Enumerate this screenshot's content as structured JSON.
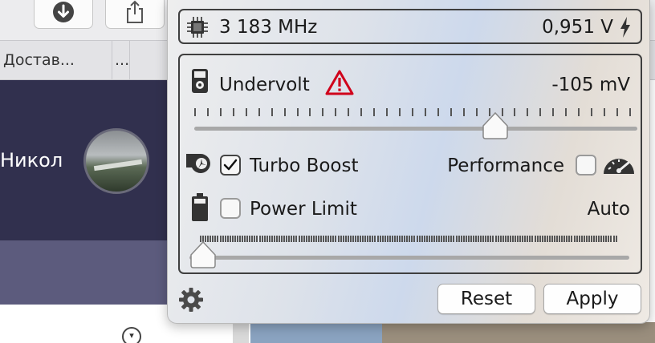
{
  "background": {
    "tabs": [
      {
        "label": "Достав..."
      },
      {
        "label": "..."
      }
    ],
    "profile_name": "Никол"
  },
  "status": {
    "cpu_frequency": "3 183 MHz",
    "core_voltage": "0,951 V"
  },
  "undervolt": {
    "label": "Undervolt",
    "value": "-105 mV",
    "slider_fraction": 0.68
  },
  "turbo_boost": {
    "label": "Turbo Boost",
    "checked": true
  },
  "performance": {
    "label": "Performance",
    "checked": false
  },
  "power_limit": {
    "label": "Power Limit",
    "checked": false,
    "value": "Auto",
    "slider_fraction": 0.0
  },
  "footer": {
    "reset_label": "Reset",
    "apply_label": "Apply"
  },
  "colors": {
    "warning": "#d0021b",
    "panel_border": "#3f3f3f",
    "background_header": "#31304e"
  },
  "icons": [
    "download-icon",
    "share-icon",
    "cpu-chip-icon",
    "bolt-icon",
    "multimeter-icon",
    "warning-icon",
    "turbo-fan-icon",
    "speedometer-icon",
    "battery-icon",
    "gear-icon"
  ]
}
